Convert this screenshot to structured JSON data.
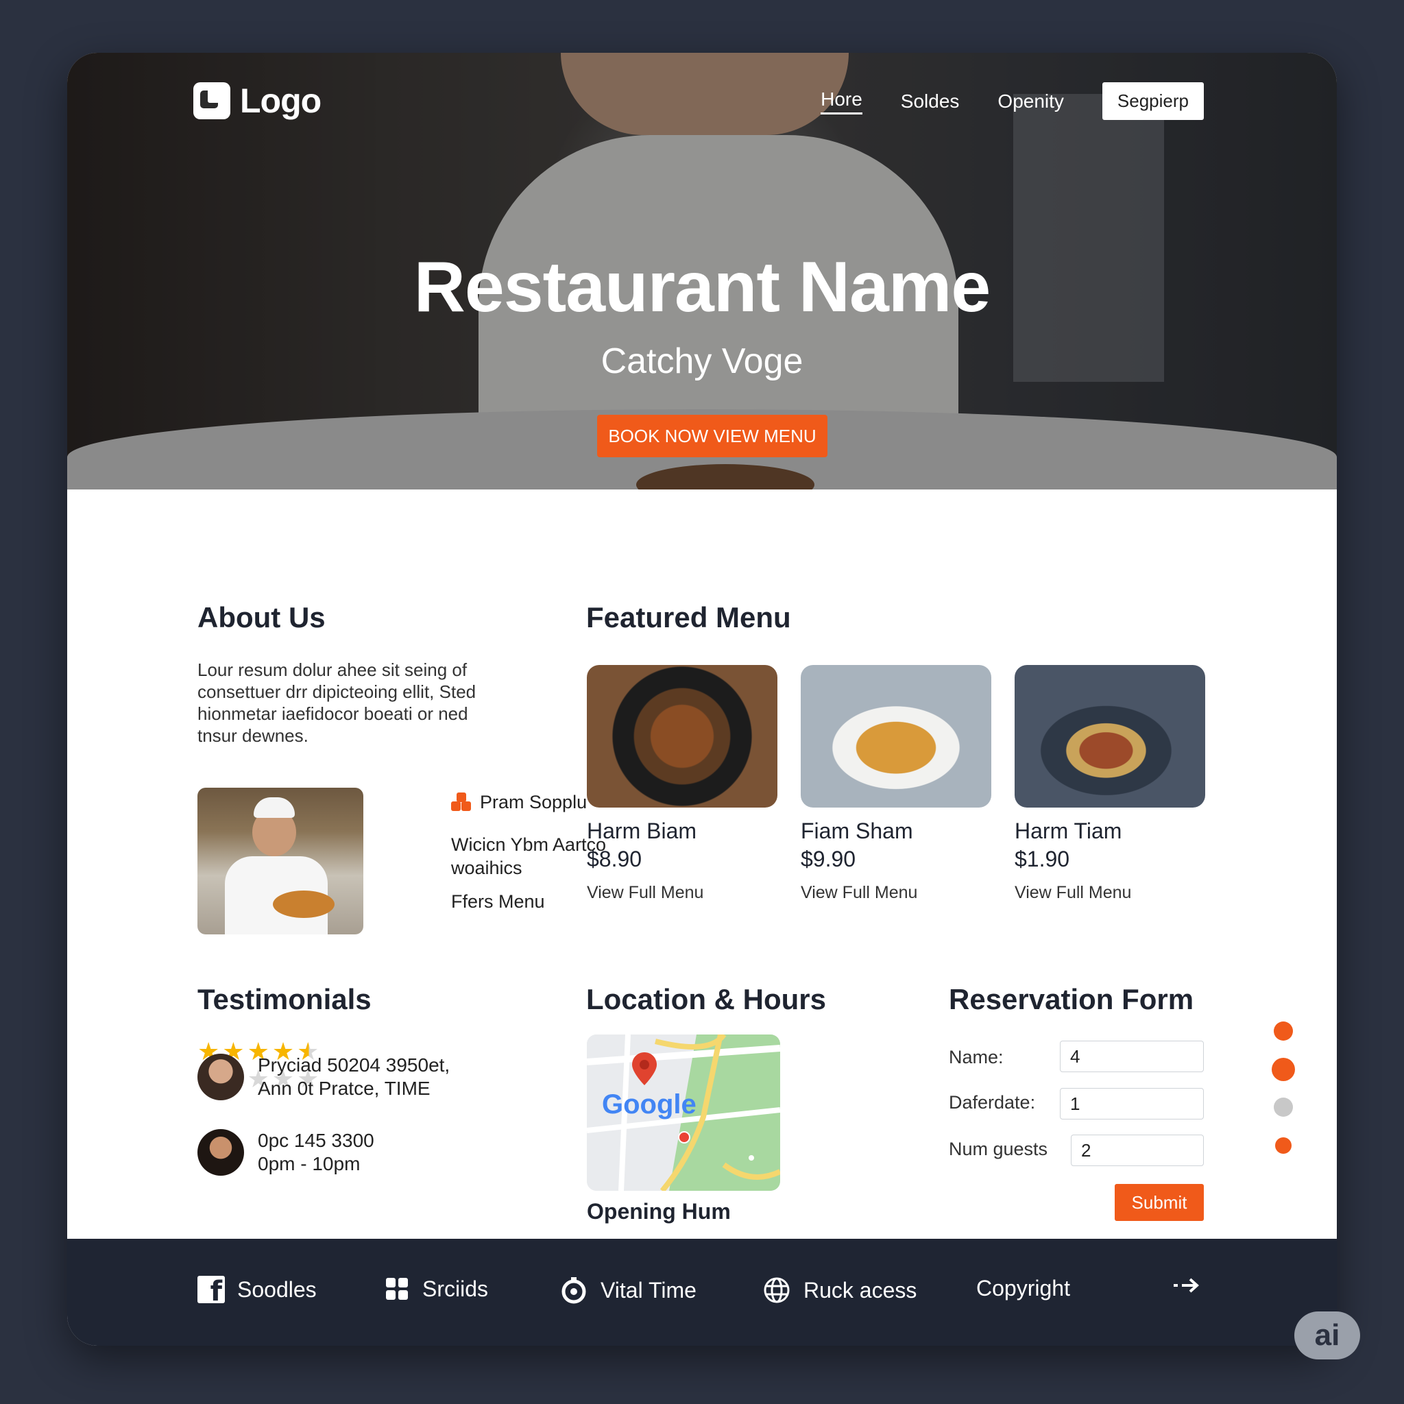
{
  "header": {
    "logo_text": "Logo",
    "nav": [
      "Hore",
      "Soldes",
      "Openity"
    ],
    "nav_button": "Segpierp"
  },
  "hero": {
    "title": "Restaurant Name",
    "subtitle": "Catchy Voge",
    "cta": "BOOK NOW VIEW MENU"
  },
  "about": {
    "heading": "About Us",
    "text": "Lour resum dolur ahee sit seing of consettuer drr dipicteoing ellit, Sted hionmetar iaefidocor boeati or ned tnsur dewnes.",
    "items": [
      "Pram Sopplu",
      "Wicicn Ybm Aartco woaihics",
      "Ffers Menu"
    ]
  },
  "menu": {
    "heading": "Featured Menu",
    "items": [
      {
        "name": "Harm Biam",
        "price": "$8.90",
        "link": "View Full Menu"
      },
      {
        "name": "Fiam Sham",
        "price": "$9.90",
        "link": "View Full Menu"
      },
      {
        "name": "Harm Tiam",
        "price": "$1.90",
        "link": "View Full Menu"
      }
    ]
  },
  "testimonials": {
    "heading": "Testimonials",
    "rating_row1": 4.5,
    "rating_row2": 2,
    "entries": [
      {
        "text": "Pryciad 50204 3950et, Ann 0t Pratce, TIME"
      },
      {
        "text": "0pc 145 3300 0pm - 10pm"
      }
    ]
  },
  "location": {
    "heading": "Location & Hours",
    "map_label": "Google",
    "opening": "Opening Hum"
  },
  "reservation": {
    "heading": "Reservation Form",
    "name_label": "Name:",
    "name_value": "4",
    "date_label": "Daferdate:",
    "date_value": "1",
    "guests_label": "Num guests",
    "guests_value": "2",
    "submit": "Submit"
  },
  "footer": {
    "items": [
      "Soodles",
      "Srciids",
      "Vital Time",
      "Ruck acess",
      "Copyright"
    ]
  },
  "badge": "ai",
  "colors": {
    "accent": "#f05a1a",
    "footer_bg": "#1f2533",
    "page_bg": "#2b3140",
    "star": "#f7b500"
  }
}
